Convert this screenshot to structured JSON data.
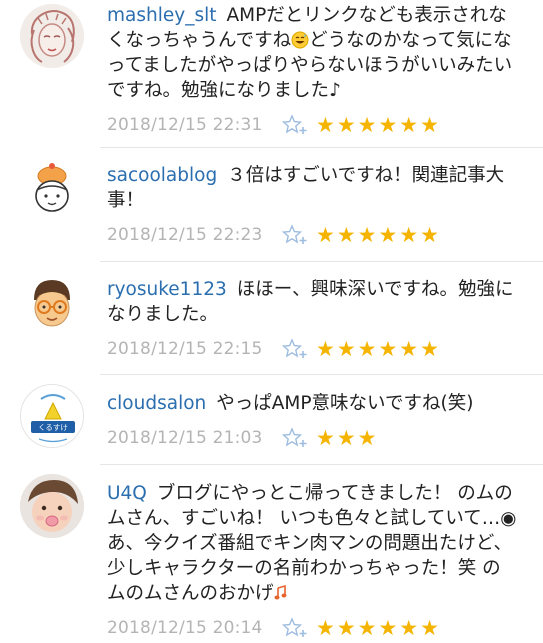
{
  "comments": [
    {
      "user": "mashley_slt",
      "text_before": "AMPだとリンクなども表示されなくなっちゃうんですね",
      "text_after": "どうなのかなって気になってましたがやっぱりやらないほうがいいみたいですね。勉強になりました♪",
      "date": "2018/12/15 22:31",
      "stars": "★★★★★★",
      "avatar": "sketch-face-avatar"
    },
    {
      "user": "sacoolablog",
      "text": "３倍はすごいですね！関連記事大事！",
      "date": "2018/12/15 22:23",
      "stars": "★★★★★★",
      "avatar": "cook-character-avatar"
    },
    {
      "user": "ryosuke1123",
      "text": "ほほー、興味深いですね。勉強になりました。",
      "date": "2018/12/15 22:15",
      "stars": "★★★★★★",
      "avatar": "glasses-man-avatar"
    },
    {
      "user": "cloudsalon",
      "text": "やっぱAMP意味ないですね(笑)",
      "date": "2018/12/15 21:03",
      "stars": "★★★",
      "avatar": "kurasuke-logo-avatar",
      "avatar_logo_text": "くるすけ"
    },
    {
      "user": "U4Q",
      "text_before": "ブログにやっとこ帰ってきました！ のムのムさん、すごいね！ いつも色々と試していて…◉ あ、今クイズ番組でキン肉マンの問題出たけど、少しキャラクターの名前わかっちゃった！笑 のムのムさんのおかげ",
      "text_after": "",
      "date": "2018/12/15 20:14",
      "stars": "★★★★★★",
      "avatar": "baby-photo-avatar"
    }
  ],
  "icons": {
    "add_star": "add-star-icon",
    "grin_emoji": "grinning-sweat-emoji",
    "music_note": "music-notes-emoji"
  },
  "colors": {
    "username": "#2a6eb0",
    "date": "#b4b4b4",
    "star": "#f4b400",
    "add_star": "#9dbcdf"
  }
}
